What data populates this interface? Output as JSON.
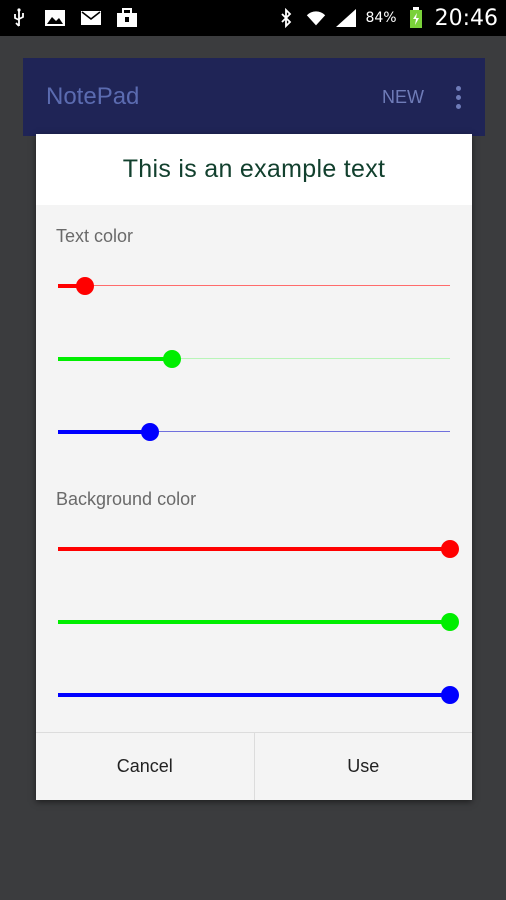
{
  "status_bar": {
    "battery": "84%",
    "time": "20:46"
  },
  "app": {
    "title": "NotePad",
    "new_label": "NEW"
  },
  "dialog": {
    "preview_text": "This is an example text",
    "text_color_label": "Text color",
    "background_color_label": "Background color",
    "text_color": {
      "red": 0.07,
      "green": 0.29,
      "blue": 0.235
    },
    "background_color": {
      "red": 1.0,
      "green": 1.0,
      "blue": 1.0
    },
    "cancel_label": "Cancel",
    "use_label": "Use"
  },
  "colors": {
    "red": "#ff0000",
    "green": "#00ee00",
    "blue": "#0000ff",
    "red_track": "#ff6b6b",
    "green_track": "#b8f5b8",
    "blue_track": "#7070dd"
  }
}
